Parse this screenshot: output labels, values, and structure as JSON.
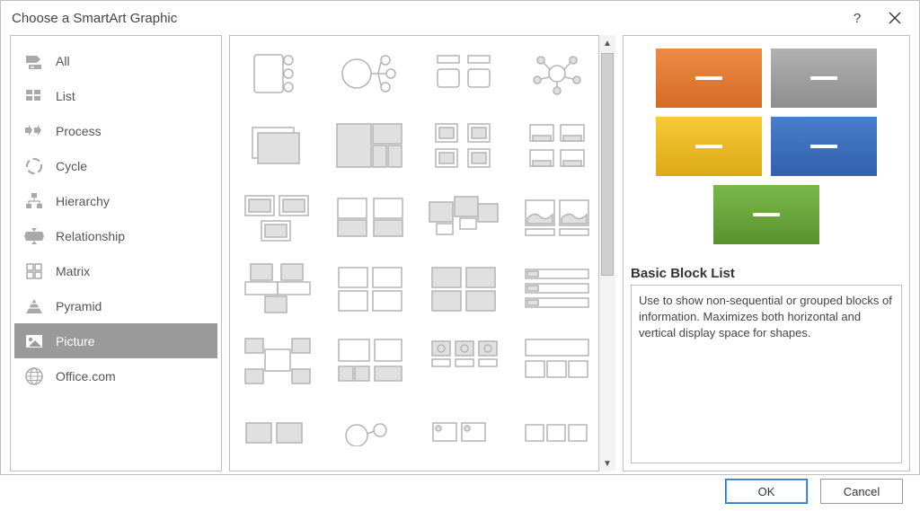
{
  "window": {
    "title": "Choose a SmartArt Graphic"
  },
  "sidebar": {
    "items": [
      {
        "label": "All"
      },
      {
        "label": "List"
      },
      {
        "label": "Process"
      },
      {
        "label": "Cycle"
      },
      {
        "label": "Hierarchy"
      },
      {
        "label": "Relationship"
      },
      {
        "label": "Matrix"
      },
      {
        "label": "Pyramid"
      },
      {
        "label": "Picture"
      },
      {
        "label": "Office.com"
      }
    ],
    "selected_index": 8
  },
  "preview": {
    "name": "Basic Block List",
    "description": "Use to show non-sequential or grouped blocks of information. Maximizes both horizontal and vertical display space for shapes.",
    "blocks": [
      {
        "color1": "#e57a2c",
        "color2": "#c96420"
      },
      {
        "color1": "#a2a2a2",
        "color2": "#8a8a8a"
      },
      {
        "color1": "#f3c021",
        "color2": "#d6a216"
      },
      {
        "color1": "#3f72c3",
        "color2": "#2f5fa8"
      },
      {
        "color1": "#6aa73a",
        "color2": "#548b2b"
      }
    ]
  },
  "footer": {
    "ok": "OK",
    "cancel": "Cancel"
  }
}
